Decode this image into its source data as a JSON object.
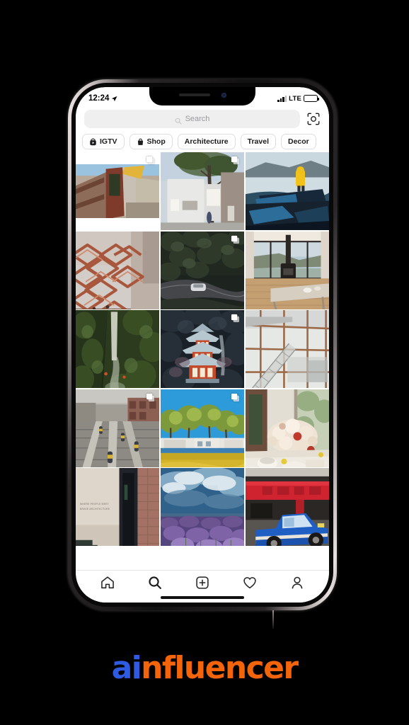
{
  "device": {
    "name": "iphone-x",
    "frame_color": "#1a1718"
  },
  "status_bar": {
    "time": "12:24",
    "location_icon": "location-arrow-icon",
    "signal_icon": "cellular-bars-icon",
    "network": "LTE",
    "battery_icon": "battery-icon",
    "battery_level": 88
  },
  "search": {
    "icon": "search-icon",
    "placeholder": "Search",
    "value": "",
    "scan_icon": "scan-code-icon"
  },
  "chips": [
    {
      "label": "IGTV",
      "icon": "igtv-icon",
      "has_icon": true
    },
    {
      "label": "Shop",
      "icon": "shopping-bag-icon",
      "has_icon": true
    },
    {
      "label": "Architecture",
      "icon": "",
      "has_icon": false
    },
    {
      "label": "Travel",
      "icon": "",
      "has_icon": false
    },
    {
      "label": "Decor",
      "icon": "",
      "has_icon": false
    }
  ],
  "grid": {
    "columns": 3,
    "tiles": [
      {
        "alt": "red-timber-walkway-architecture",
        "multi": true,
        "letterbox": true
      },
      {
        "alt": "white-modern-house-with-tree",
        "multi": true,
        "letterbox": false
      },
      {
        "alt": "person-in-yellow-raincoat-on-boat",
        "multi": false,
        "letterbox": false
      },
      {
        "alt": "vessel-hudson-yards-staircase",
        "multi": false,
        "letterbox": false
      },
      {
        "alt": "aerial-forest-road-with-car",
        "multi": true,
        "letterbox": false
      },
      {
        "alt": "modern-interior-with-woodstove",
        "multi": false,
        "letterbox": false
      },
      {
        "alt": "waterfall-in-green-gorge",
        "multi": false,
        "letterbox": false
      },
      {
        "alt": "japanese-pagoda-at-night",
        "multi": true,
        "letterbox": false
      },
      {
        "alt": "glass-atrium-with-staircase",
        "multi": false,
        "letterbox": false
      },
      {
        "alt": "railway-tracks-workers-city",
        "multi": true,
        "letterbox": false
      },
      {
        "alt": "park-with-trees-and-blue-sky",
        "multi": true,
        "letterbox": false
      },
      {
        "alt": "flower-bouquet-on-table-by-window",
        "multi": false,
        "letterbox": false
      },
      {
        "alt": "brick-wall-with-signage",
        "multi": false,
        "letterbox": false,
        "sign_lines": [
          "WHERE PEOPLE MEET",
          "BRAVE ARCHITECTURE"
        ]
      },
      {
        "alt": "lavender-field-under-clouds",
        "multi": false,
        "letterbox": false
      },
      {
        "alt": "blue-pickup-truck-by-red-building",
        "multi": false,
        "letterbox": false
      }
    ]
  },
  "tab_bar": {
    "items": [
      {
        "name": "home-icon",
        "label": "Home",
        "active": false
      },
      {
        "name": "search-icon",
        "label": "Search",
        "active": true
      },
      {
        "name": "add-post-icon",
        "label": "Create",
        "active": false
      },
      {
        "name": "heart-icon",
        "label": "Activity",
        "active": false
      },
      {
        "name": "profile-icon",
        "label": "Profile",
        "active": false
      }
    ]
  },
  "branding": {
    "logo_a": "a",
    "logo_i": "i",
    "logo_rest": "nfluencer",
    "blue": "#2f5be0",
    "orange": "#f4640b"
  }
}
